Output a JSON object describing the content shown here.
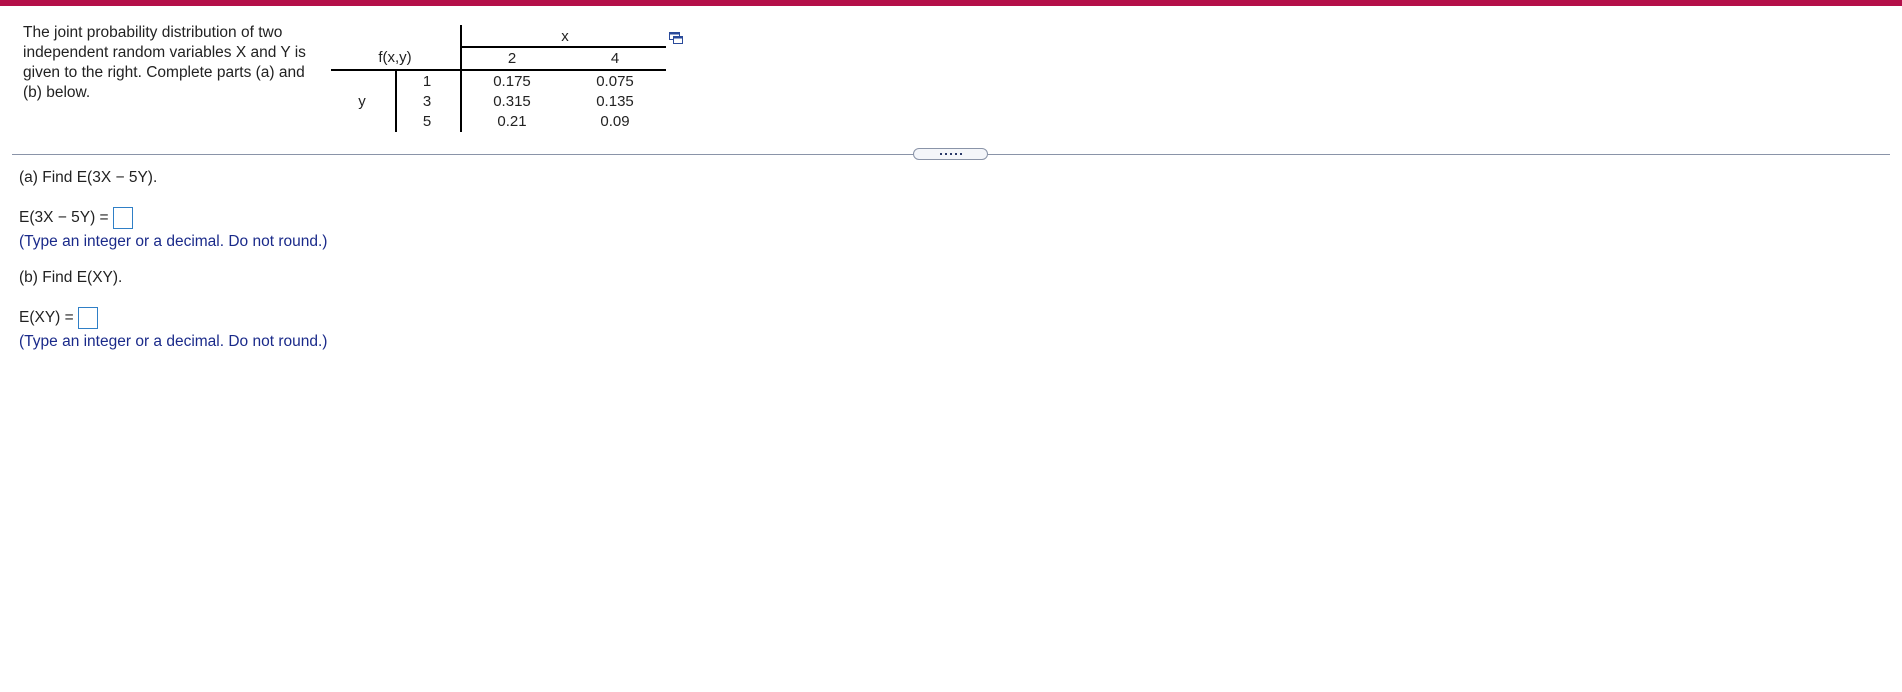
{
  "colors": {
    "top_bar": "#b40f49",
    "hint_text": "#1a2a8a",
    "answer_box_border": "#2f7fc6",
    "divider": "#8a94a8"
  },
  "intro": {
    "text": "The joint probability distribution of two independent random variables X and Y is given to the right. Complete parts (a) and (b) below."
  },
  "table": {
    "corner_label": "f(x,y)",
    "x_label": "x",
    "y_label": "y",
    "x_values": [
      "2",
      "4"
    ],
    "y_values": [
      "1",
      "3",
      "5"
    ],
    "rows": [
      [
        "0.175",
        "0.075"
      ],
      [
        "0.315",
        "0.135"
      ],
      [
        "0.21",
        "0.09"
      ]
    ]
  },
  "icons": {
    "popout": "popout-window-icon",
    "splitter": "splitter-handle"
  },
  "part_a": {
    "prompt": "(a) Find E(3X − 5Y).",
    "answer_label": "E(3X − 5Y) =",
    "hint": "(Type an integer or a decimal. Do not round.)"
  },
  "part_b": {
    "prompt": "(b) Find E(XY).",
    "answer_label": "E(XY) =",
    "hint": "(Type an integer or a decimal. Do not round.)"
  }
}
